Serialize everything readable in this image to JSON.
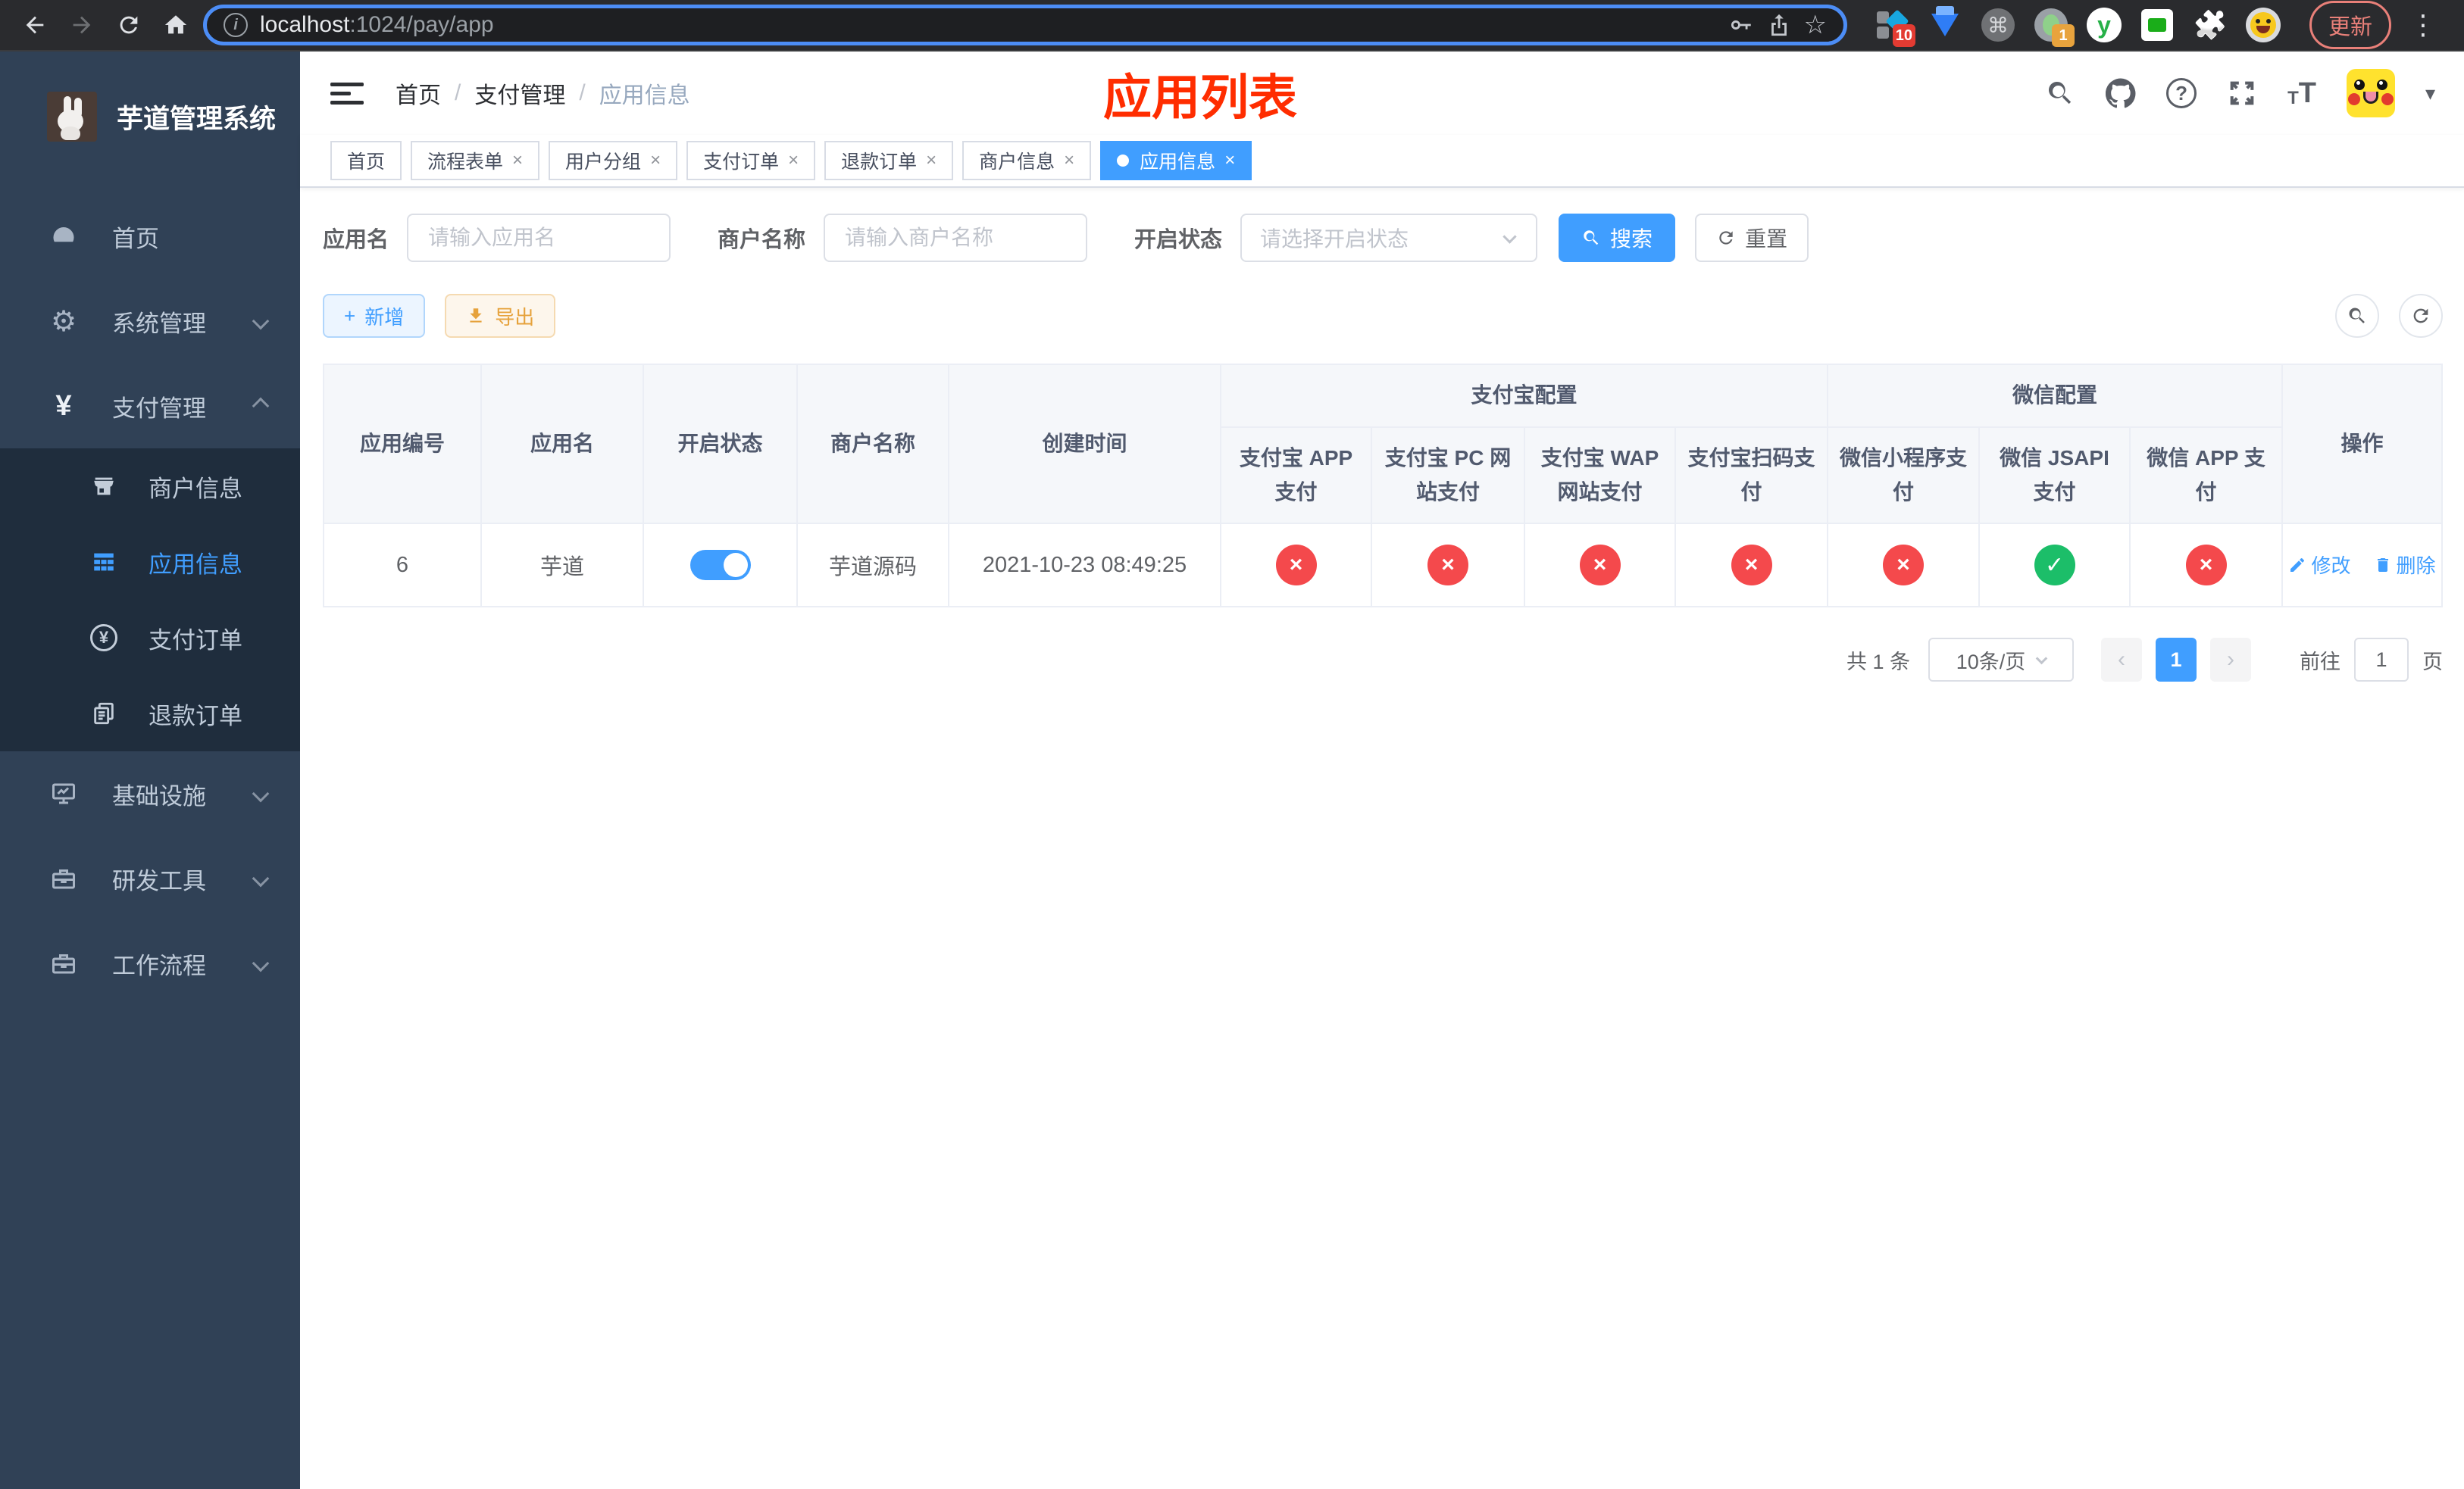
{
  "browser": {
    "url_host": "localhost",
    "url_rest": ":1024/pay/app",
    "update_label": "更新",
    "badge_ten": "10",
    "badge_one": "1"
  },
  "icons": {
    "info": "i",
    "star": "☆",
    "command": "⌘",
    "puzzle": "🧩",
    "y_letter": "y",
    "kebab": "⋮",
    "caret": "▾",
    "question": "?",
    "plus": "+",
    "yen": "¥",
    "close": "×",
    "cross": "×",
    "check": "✓",
    "prev": "‹",
    "next": "›"
  },
  "sidebar": {
    "title": "芋道管理系统",
    "menu": [
      {
        "label": "首页"
      },
      {
        "label": "系统管理"
      },
      {
        "label": "支付管理"
      }
    ],
    "submenu": [
      {
        "label": "商户信息"
      },
      {
        "label": "应用信息"
      },
      {
        "label": "支付订单"
      },
      {
        "label": "退款订单"
      }
    ],
    "menu2": [
      {
        "label": "基础设施"
      },
      {
        "label": "研发工具"
      },
      {
        "label": "工作流程"
      }
    ]
  },
  "header": {
    "breadcrumb": [
      "首页",
      "支付管理",
      "应用信息"
    ],
    "overlay_title": "应用列表"
  },
  "tabs": [
    {
      "label": "首页"
    },
    {
      "label": "流程表单"
    },
    {
      "label": "用户分组"
    },
    {
      "label": "支付订单"
    },
    {
      "label": "退款订单"
    },
    {
      "label": "商户信息"
    },
    {
      "label": "应用信息"
    }
  ],
  "filters": {
    "app_name_label": "应用名",
    "app_name_placeholder": "请输入应用名",
    "merchant_label": "商户名称",
    "merchant_placeholder": "请输入商户名称",
    "status_label": "开启状态",
    "status_placeholder": "请选择开启状态",
    "search_button": "搜索",
    "reset_button": "重置"
  },
  "toolbar": {
    "add_button": "新增",
    "export_button": "导出"
  },
  "table": {
    "col_id": "应用编号",
    "col_name": "应用名",
    "col_status": "开启状态",
    "col_merchant": "商户名称",
    "col_created": "创建时间",
    "group_alipay": "支付宝配置",
    "group_wechat": "微信配置",
    "col_alipay_app": "支付宝 APP 支付",
    "col_alipay_pc": "支付宝 PC 网站支付",
    "col_alipay_wap": "支付宝 WAP 网站支付",
    "col_alipay_qr": "支付宝扫码支付",
    "col_wx_lite": "微信小程序支付",
    "col_wx_jsapi": "微信 JSAPI 支付",
    "col_wx_app": "微信 APP 支付",
    "col_actions": "操作",
    "row": {
      "id": "6",
      "name": "芋道",
      "enabled": true,
      "merchant": "芋道源码",
      "created": "2021-10-23 08:49:25",
      "alipay_app": false,
      "alipay_pc": false,
      "alipay_wap": false,
      "alipay_qr": false,
      "wx_lite": false,
      "wx_jsapi": true,
      "wx_app": false
    },
    "edit_label": "修改",
    "delete_label": "删除"
  },
  "pagination": {
    "total_text": "共 1 条",
    "page_size": "10条/页",
    "current_page": "1",
    "goto_label": "前往",
    "goto_value": "1",
    "page_unit": "页"
  },
  "colors": {
    "accent": "#409eff",
    "danger": "#f4494c",
    "success": "#1cbe69",
    "warning": "#e6a23c",
    "overlay_title_red": "#ff2d00",
    "sidebar_bg": "#304156",
    "submenu_bg": "#1f2d3d"
  }
}
